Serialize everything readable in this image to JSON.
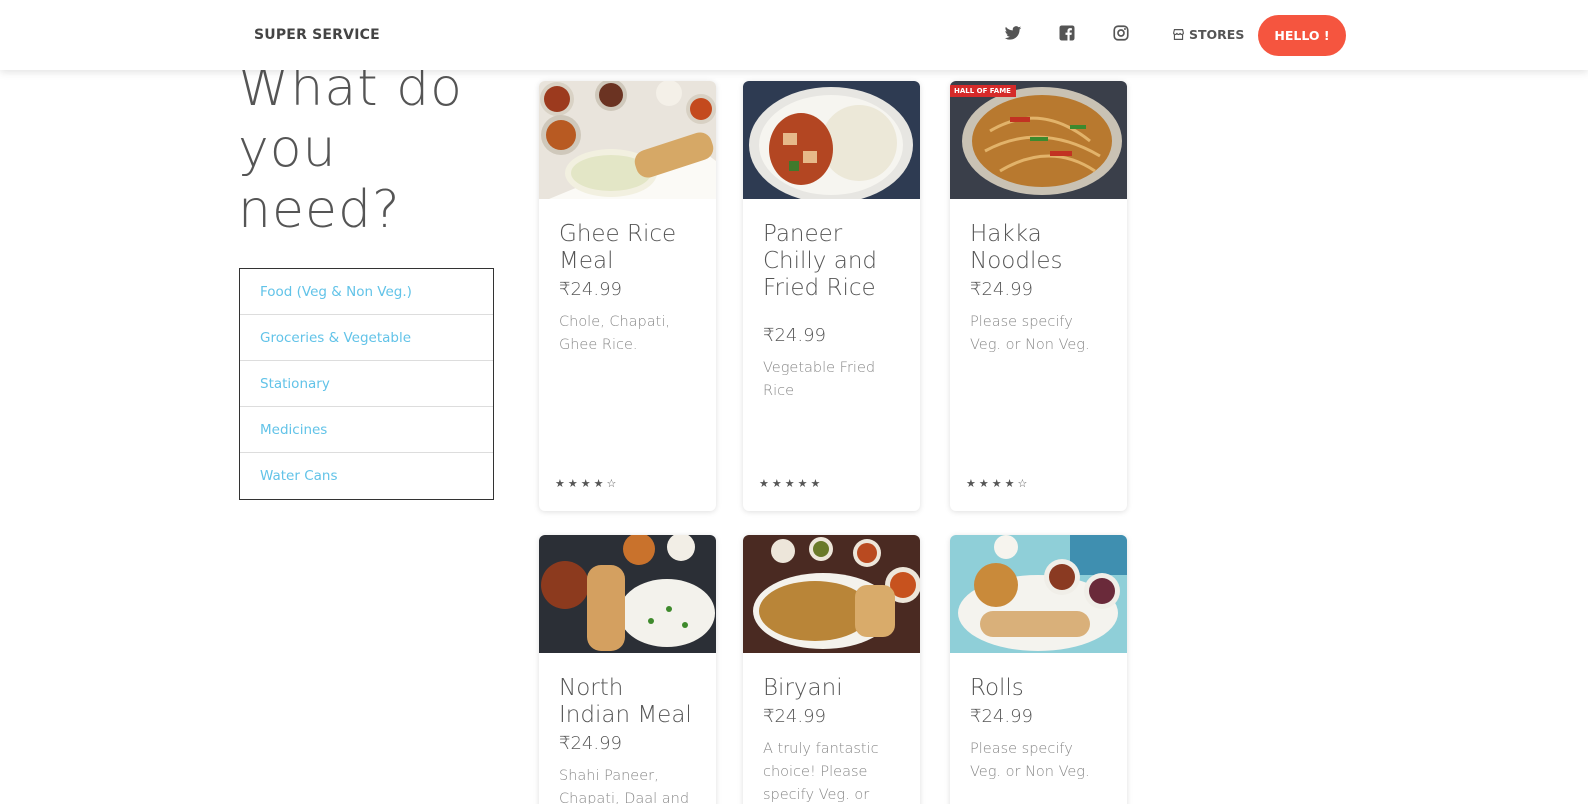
{
  "nav": {
    "brand": "SUPER SERVICE",
    "icons": [
      "twitter-icon",
      "facebook-icon",
      "instagram-icon"
    ],
    "stores_label": "STORES",
    "hello_label": "HELLO !",
    "accent_color": "#f5553f"
  },
  "headline": "What do you need?",
  "categories": [
    "Food (Veg & Non Veg.)",
    "Groceries & Vegetable",
    "Stationary",
    "Medicines",
    "Water Cans"
  ],
  "products": [
    {
      "title": "Ghee Rice Meal",
      "price": "₹24.99",
      "description": "Chole, Chapati, Ghee Rice.",
      "stars": "★★★★☆"
    },
    {
      "title": "Paneer Chilly and Fried Rice",
      "price": "₹24.99",
      "description": "Vegetable Fried Rice",
      "stars": "★★★★★"
    },
    {
      "title": "Hakka Noodles",
      "price": "₹24.99",
      "description": "Please specify Veg. or Non Veg.",
      "stars": "★★★★☆",
      "badge": "HALL OF FAME"
    },
    {
      "title": "North Indian Meal",
      "price": "₹24.99",
      "description": "Shahi Paneer, Chapati, Daal and"
    },
    {
      "title": "Biryani",
      "price": "₹24.99",
      "description": "A truly fantastic choice! Please specify Veg. or"
    },
    {
      "title": "Rolls",
      "price": "₹24.99",
      "description": "Please specify Veg. or Non Veg."
    }
  ]
}
